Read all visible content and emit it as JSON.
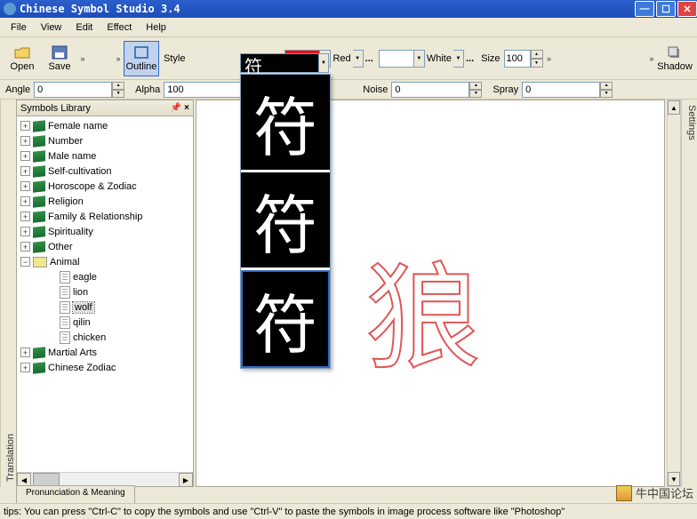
{
  "window": {
    "title": "Chinese Symbol Studio 3.4"
  },
  "menu": [
    "File",
    "View",
    "Edit",
    "Effect",
    "Help"
  ],
  "toolbar": {
    "open": "Open",
    "save": "Save",
    "outline": "Outline",
    "style_label": "Style",
    "color1": {
      "hex": "#ff0000",
      "name": "Red"
    },
    "color2": {
      "hex": "#ffffff",
      "name": "White"
    },
    "size_label": "Size",
    "size_value": "100",
    "shadow": "Shadow"
  },
  "params": {
    "angle_label": "Angle",
    "angle_value": "0",
    "alpha_label": "Alpha",
    "alpha_value": "100",
    "noise_label": "Noise",
    "noise_value": "0",
    "spray_label": "Spray",
    "spray_value": "0"
  },
  "sidebar": {
    "title": "Symbols Library",
    "categories": [
      "Female name",
      "Number",
      "Male name",
      "Self-cultivation",
      "Horoscope & Zodiac",
      "Religion",
      "Family & Relationship",
      "Spirituality",
      "Other"
    ],
    "animal_label": "Animal",
    "animals": [
      "eagle",
      "lion",
      "wolf",
      "qilin",
      "chicken"
    ],
    "selected_animal": "wolf",
    "tail": [
      "Martial Arts",
      "Chinese Zodiac"
    ]
  },
  "style_dropdown": {
    "char": "符",
    "selected_index": 2
  },
  "canvas": {
    "glyph": "狼",
    "outline_color": "#e05555"
  },
  "side_tabs": {
    "left": "Translation",
    "right": "Settings"
  },
  "bottom_tab": "Pronunciation & Meaning",
  "statusbar": "tips: You can press \"Ctrl-C\" to copy the symbols and use \"Ctrl-V\" to paste the symbols in image process software like \"Photoshop\"",
  "watermark": "牛中国论坛"
}
